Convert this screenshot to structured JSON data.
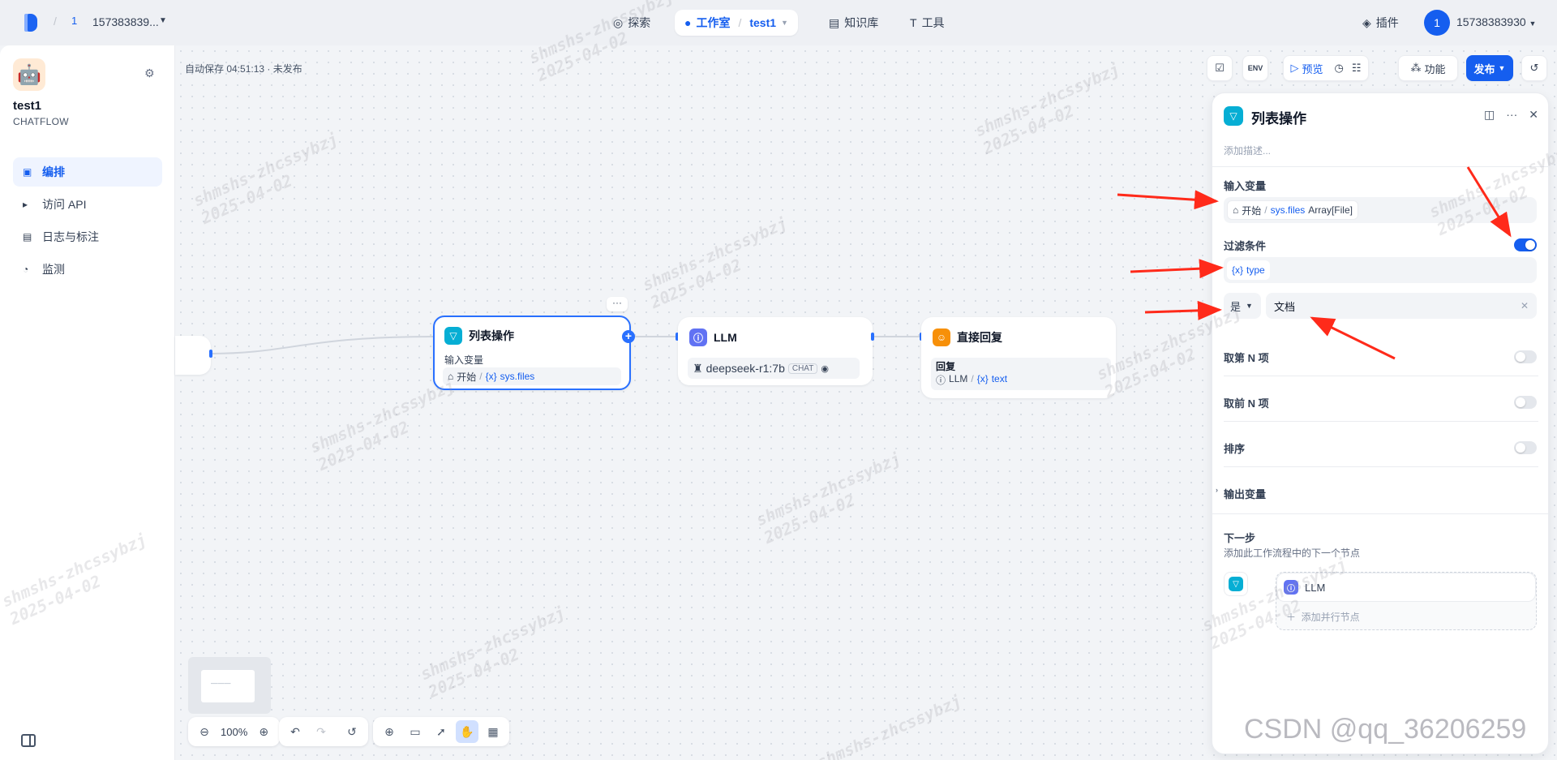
{
  "topbar": {
    "workspace_badge": "1",
    "workspace_name": "157383839...",
    "nav": [
      {
        "label": "探索"
      },
      {
        "label": "工作室",
        "current_app": "test1"
      },
      {
        "label": "知识库"
      },
      {
        "label": "工具"
      }
    ],
    "plugin_label": "插件",
    "avatar_letter": "1",
    "username": "15738383930"
  },
  "sidebar": {
    "app_name": "test1",
    "app_type": "CHATFLOW",
    "menu": [
      {
        "label": "编排",
        "active": true
      },
      {
        "label": "访问 API"
      },
      {
        "label": "日志与标注"
      },
      {
        "label": "监测"
      }
    ]
  },
  "canvas": {
    "autosave": "自动保存 04:51:13 · 未发布",
    "toolbar": {
      "env_label": "ENV",
      "preview": "预览",
      "features": "功能",
      "publish": "发布"
    },
    "zoom": "100%"
  },
  "nodes": {
    "list_op": {
      "title": "列表操作",
      "input_label": "输入变量",
      "source": "开始",
      "var": "sys.files"
    },
    "llm": {
      "title": "LLM",
      "model": "deepseek-r1:7b",
      "model_tag": "CHAT"
    },
    "answer": {
      "title": "直接回复",
      "label": "回复",
      "source": "LLM",
      "var": "text"
    }
  },
  "panel": {
    "title": "列表操作",
    "desc_placeholder": "添加描述...",
    "input_label": "输入变量",
    "input_source": "开始",
    "input_var": "sys.files",
    "input_type": "Array[File]",
    "filter_label": "过滤条件",
    "filter_on": true,
    "filter_var": "type",
    "cond_op": "是",
    "cond_value": "文档",
    "nth_label": "取第 N 项",
    "first_n_label": "取前 N 项",
    "sort_label": "排序",
    "output_label": "输出变量",
    "next_title": "下一步",
    "next_sub": "添加此工作流程中的下一个节点",
    "next_node": "LLM",
    "add_parallel": "添加并行节点"
  },
  "watermark": {
    "line1": "shmshs-zhcssybzj",
    "line2": "2025-04-02",
    "csdn": "CSDN @qq_36206259"
  },
  "colors": {
    "accent": "#155eef",
    "node_cyan": "#06aed4",
    "node_indigo": "#6172f3",
    "node_orange": "#f79009",
    "annotation_red": "#ff2a1a"
  }
}
